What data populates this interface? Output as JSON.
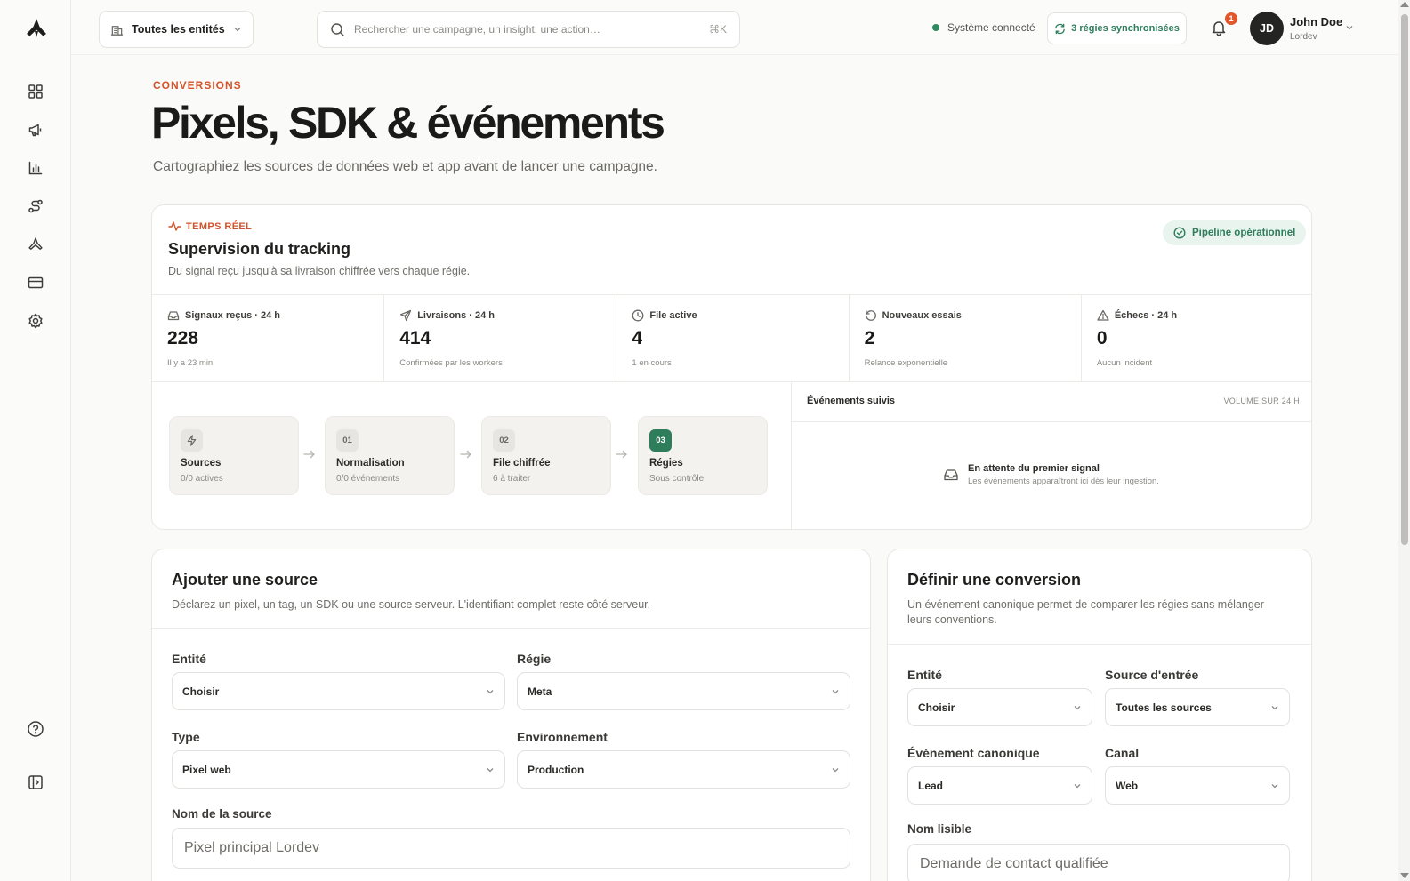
{
  "topbar": {
    "entity_select": "Toutes les entités",
    "search_placeholder": "Rechercher une campagne, un insight, une action…",
    "search_shortcut": "⌘K",
    "system_status": "Système connecté",
    "sync_label": "3 régies synchronisées",
    "notifications_count": "1",
    "user_initials": "JD",
    "user_name": "John Doe",
    "user_org": "Lordev"
  },
  "sidebar": {
    "items": [
      "dashboard-icon",
      "megaphone-icon",
      "bar-chart-icon",
      "route-icon",
      "brand-icon",
      "credit-card-icon",
      "settings-icon"
    ],
    "footer": [
      "help-icon",
      "collapse-sidebar-icon"
    ]
  },
  "header": {
    "eyebrow": "CONVERSIONS",
    "title": "Pixels, SDK & événements",
    "subtitle": "Cartographiez les sources de données web et app avant de lancer une campagne."
  },
  "tracking": {
    "realtime_label": "TEMPS RÉEL",
    "title": "Supervision du tracking",
    "description": "Du signal reçu jusqu'à sa livraison chiffrée vers chaque régie.",
    "pipeline_status": "Pipeline opérationnel",
    "stats": [
      {
        "label": "Signaux reçus · 24 h",
        "value": "228",
        "note": "Il y a 23 min"
      },
      {
        "label": "Livraisons · 24 h",
        "value": "414",
        "note": "Confirmées par les workers"
      },
      {
        "label": "File active",
        "value": "4",
        "note": "1 en cours"
      },
      {
        "label": "Nouveaux essais",
        "value": "2",
        "note": "Relance exponentielle"
      },
      {
        "label": "Échecs · 24 h",
        "value": "0",
        "note": "Aucun incident"
      }
    ],
    "steps": [
      {
        "badge": "",
        "title": "Sources",
        "sub": "0/0 actives"
      },
      {
        "badge": "01",
        "title": "Normalisation",
        "sub": "0/0 événements"
      },
      {
        "badge": "02",
        "title": "File chiffrée",
        "sub": "6 à traiter"
      },
      {
        "badge": "03",
        "title": "Régies",
        "sub": "Sous contrôle"
      }
    ],
    "events": {
      "title": "Événements suivis",
      "volume_label": "VOLUME SUR 24 H",
      "empty_title": "En attente du premier signal",
      "empty_sub": "Les événements apparaîtront ici dès leur ingestion."
    }
  },
  "add_source": {
    "title": "Ajouter une source",
    "description": "Déclarez un pixel, un tag, un SDK ou une source serveur. L'identifiant complet reste côté serveur.",
    "entity_label": "Entité",
    "entity_value": "Choisir",
    "regie_label": "Régie",
    "regie_value": "Meta",
    "type_label": "Type",
    "type_value": "Pixel web",
    "env_label": "Environnement",
    "env_value": "Production",
    "name_label": "Nom de la source",
    "name_placeholder": "Pixel principal Lordev"
  },
  "conversion": {
    "title": "Définir une conversion",
    "description": "Un événement canonique permet de comparer les régies sans mélanger leurs conventions.",
    "entity_label": "Entité",
    "entity_value": "Choisir",
    "source_label": "Source d'entrée",
    "source_value": "Toutes les sources",
    "event_label": "Événement canonique",
    "event_value": "Lead",
    "channel_label": "Canal",
    "channel_value": "Web",
    "name_label": "Nom lisible",
    "name_placeholder": "Demande de contact qualifiée"
  }
}
